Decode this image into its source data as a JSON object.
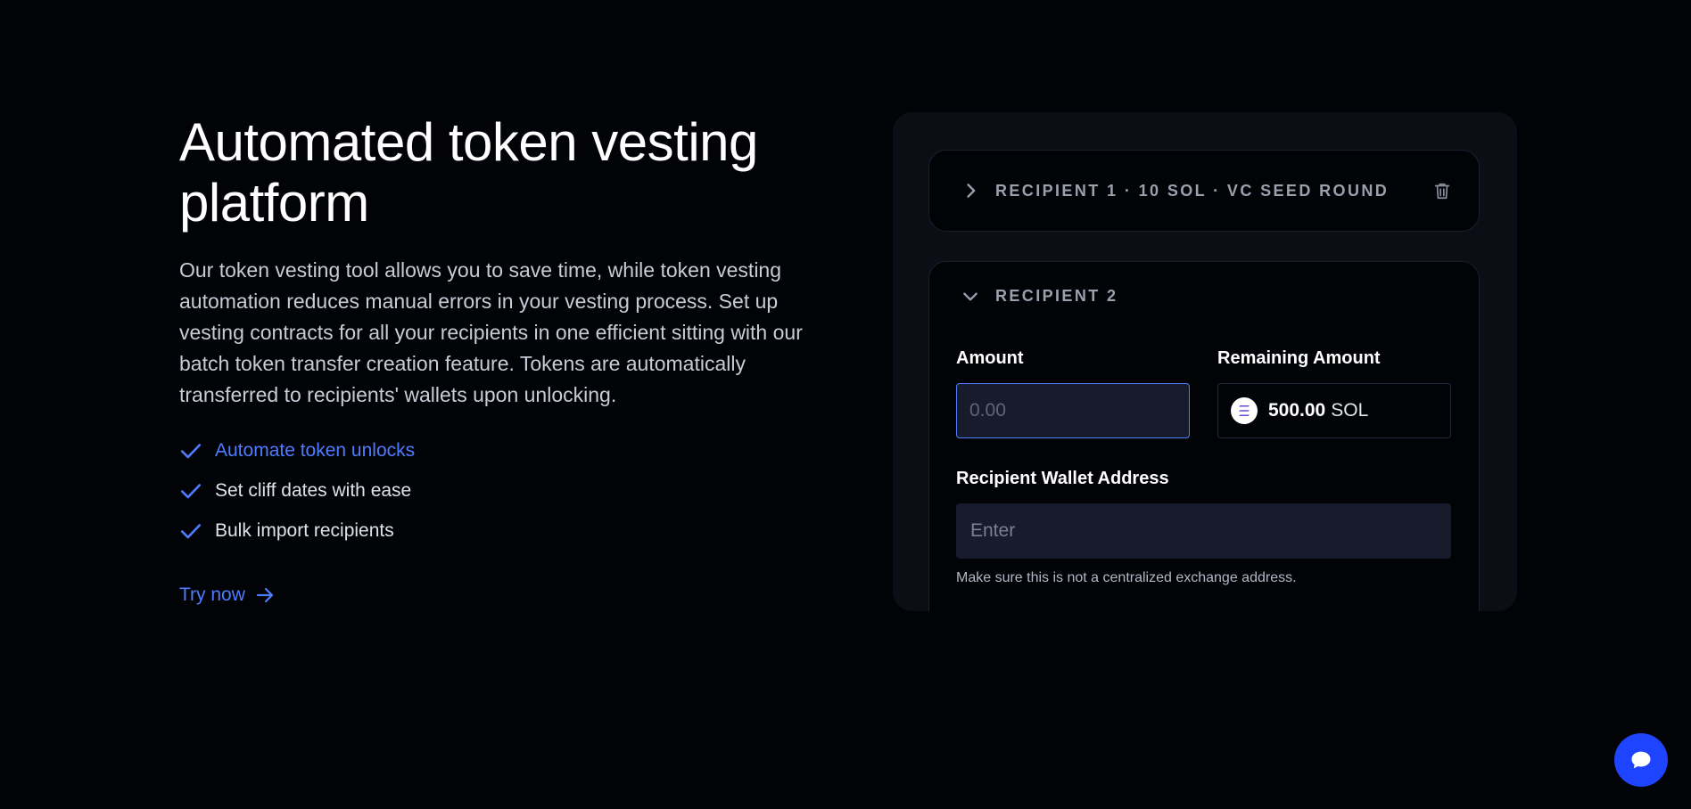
{
  "hero": {
    "title": "Automated token vesting platform",
    "description": "Our token vesting tool allows you to save time, while token vesting automation reduces manual errors in your vesting process. Set up vesting contracts for all your recipients in one efficient sitting with our batch token transfer creation feature. Tokens are automatically transferred to recipients' wallets upon unlocking.",
    "features": [
      {
        "label": "Automate token unlocks",
        "active": true
      },
      {
        "label": "Set cliff dates with ease",
        "active": false
      },
      {
        "label": "Bulk import recipients",
        "active": false
      }
    ],
    "cta_label": "Try now"
  },
  "panel": {
    "recipient1": {
      "title": "RECIPIENT 1 · 10 SOL · VC SEED ROUND"
    },
    "recipient2": {
      "title": "RECIPIENT 2",
      "amount_label": "Amount",
      "amount_placeholder": "0.00",
      "amount_value": "",
      "remaining_label": "Remaining Amount",
      "remaining_value": "500.00",
      "remaining_unit": "SOL",
      "wallet_label": "Recipient Wallet Address",
      "wallet_placeholder": "Enter",
      "wallet_value": "",
      "wallet_hint": "Make sure this is not a centralized exchange address."
    }
  },
  "colors": {
    "accent": "#4f7cff",
    "chat_button": "#1f44ff",
    "background": "#020307",
    "panel": "#0b0e15"
  },
  "icons": {
    "feature": "check-icon",
    "cta": "arrow-right-icon",
    "collapsed": "chevron-right-icon",
    "expanded": "chevron-down-icon",
    "delete": "trash-icon",
    "token": "solana-icon",
    "chat": "chat-bubble-icon"
  }
}
